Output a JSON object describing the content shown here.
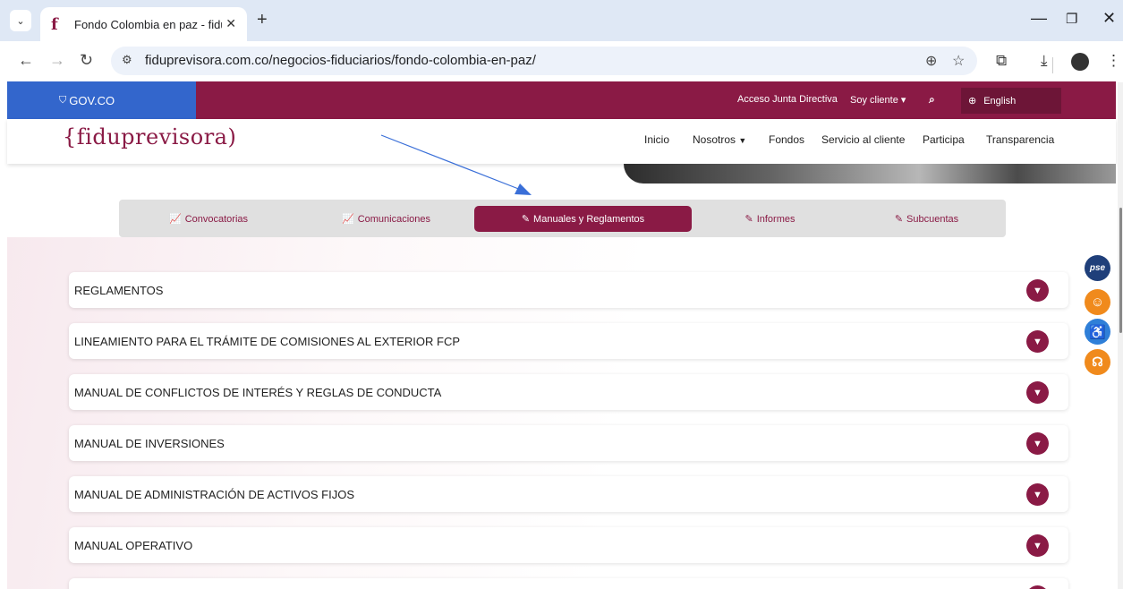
{
  "browser": {
    "tab_title": "Fondo Colombia en paz - fidup",
    "url": "fiduprevisora.com.co/negocios-fiduciarios/fondo-colombia-en-paz/"
  },
  "govbar": {
    "brand": "GOV.CO",
    "links": [
      "Acceso Junta Directiva",
      "Soy cliente"
    ],
    "language": "English"
  },
  "header": {
    "logo": "{fiduprevisora)",
    "nav": [
      "Inicio",
      "Nosotros",
      "Fondos",
      "Servicio al cliente",
      "Participa",
      "Transparencia"
    ]
  },
  "content_tabs": [
    {
      "label": "Convocatorias",
      "icon": "chart-line-icon",
      "active": false
    },
    {
      "label": "Comunicaciones",
      "icon": "chart-line-icon",
      "active": false
    },
    {
      "label": "Manuales y Reglamentos",
      "icon": "edit-icon",
      "active": true
    },
    {
      "label": "Informes",
      "icon": "edit-icon",
      "active": false
    },
    {
      "label": "Subcuentas",
      "icon": "edit-icon",
      "active": false
    }
  ],
  "accordion": [
    "REGLAMENTOS",
    "LINEAMIENTO PARA EL TRÁMITE DE COMISIONES AL EXTERIOR FCP",
    "MANUAL DE CONFLICTOS DE INTERÉS Y REGLAS DE CONDUCTA",
    "MANUAL DE INVERSIONES",
    "MANUAL DE ADMINISTRACIÓN DE ACTIVOS FIJOS",
    "MANUAL OPERATIVO"
  ],
  "floating": {
    "pse": "pse"
  },
  "colors": {
    "brand": "#8a1a45",
    "gov_blue": "#3366cc",
    "arrow": "#3a6fd8"
  }
}
